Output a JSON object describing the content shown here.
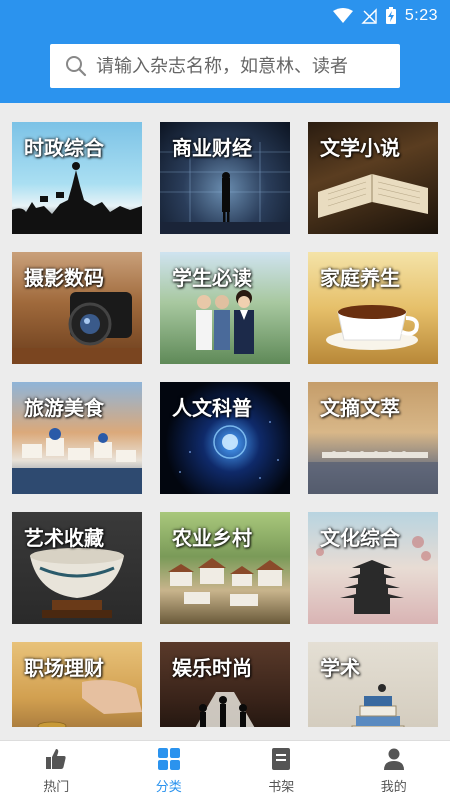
{
  "status": {
    "time": "5:23"
  },
  "search": {
    "placeholder": "请输入杂志名称，如意林、读者"
  },
  "categories": [
    {
      "label": "时政综合",
      "icon": "politics-image"
    },
    {
      "label": "商业财经",
      "icon": "business-image"
    },
    {
      "label": "文学小说",
      "icon": "literature-image"
    },
    {
      "label": "摄影数码",
      "icon": "photography-image"
    },
    {
      "label": "学生必读",
      "icon": "student-image"
    },
    {
      "label": "家庭养生",
      "icon": "family-health-image"
    },
    {
      "label": "旅游美食",
      "icon": "travel-food-image"
    },
    {
      "label": "人文科普",
      "icon": "humanities-image"
    },
    {
      "label": "文摘文萃",
      "icon": "digest-image"
    },
    {
      "label": "艺术收藏",
      "icon": "art-collection-image"
    },
    {
      "label": "农业乡村",
      "icon": "agriculture-image"
    },
    {
      "label": "文化综合",
      "icon": "culture-image"
    },
    {
      "label": "职场理财",
      "icon": "career-finance-image"
    },
    {
      "label": "娱乐时尚",
      "icon": "entertainment-image"
    },
    {
      "label": "学术",
      "icon": "academic-image"
    }
  ],
  "tabs": [
    {
      "label": "热门",
      "icon": "thumbs-up-icon",
      "active": false
    },
    {
      "label": "分类",
      "icon": "grid-icon",
      "active": true
    },
    {
      "label": "书架",
      "icon": "bookshelf-icon",
      "active": false
    },
    {
      "label": "我的",
      "icon": "person-icon",
      "active": false
    }
  ],
  "colors": {
    "accent": "#2b93ee",
    "background": "#ececec",
    "tab_inactive": "#555555"
  }
}
